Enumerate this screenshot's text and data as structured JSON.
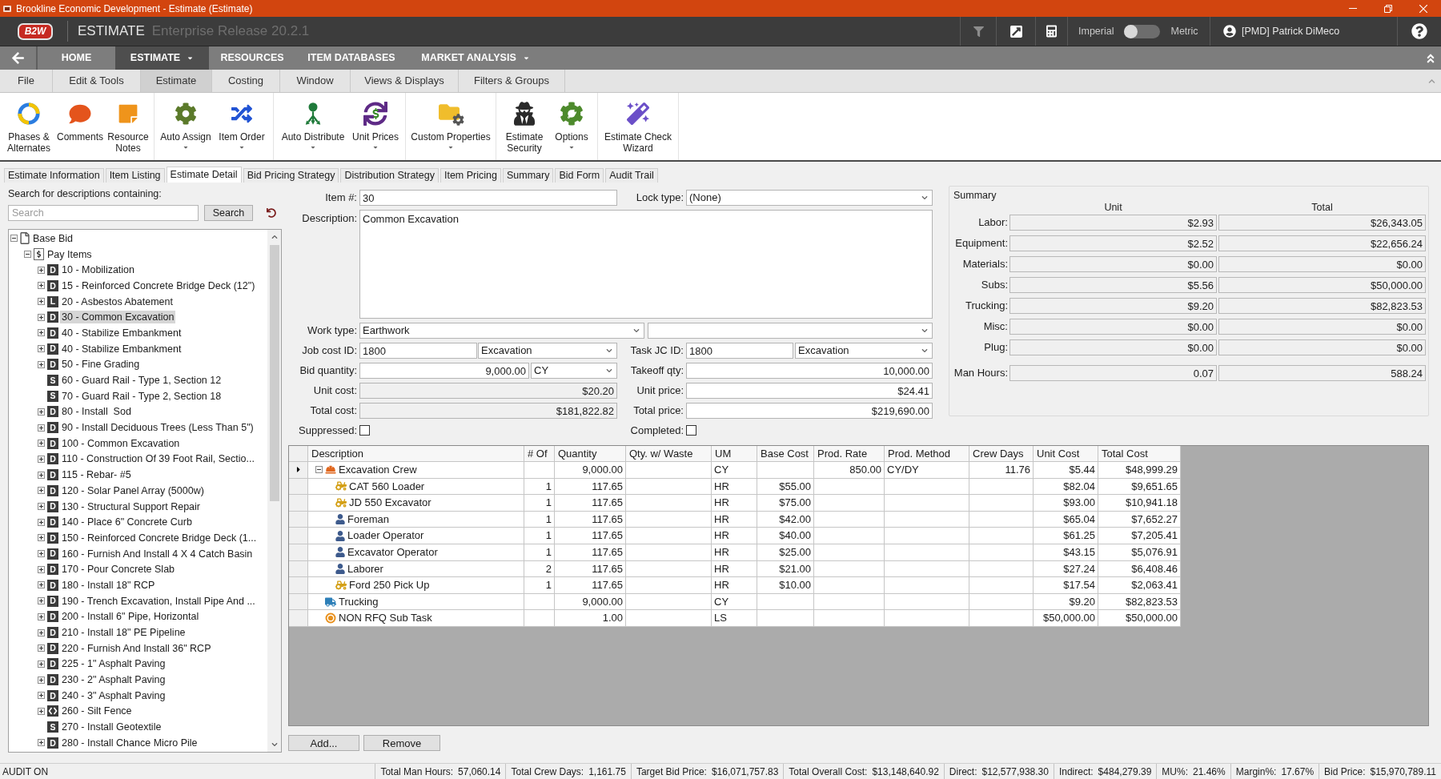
{
  "title_bar": {
    "title": "Brookline Economic Development - Estimate (Estimate)"
  },
  "header": {
    "logo": "B2W",
    "product": "ESTIMATE",
    "release": "Enterprise Release 20.2.1",
    "units": {
      "left": "Imperial",
      "right": "Metric",
      "metric": false
    },
    "user": "[PMD] Patrick DiMeco"
  },
  "nav": [
    {
      "label": "HOME",
      "selected": false,
      "dropdown": false
    },
    {
      "label": "ESTIMATE",
      "selected": true,
      "dropdown": true
    },
    {
      "label": "RESOURCES",
      "selected": false,
      "dropdown": false
    },
    {
      "label": "ITEM DATABASES",
      "selected": false,
      "dropdown": false
    },
    {
      "label": "MARKET ANALYSIS",
      "selected": false,
      "dropdown": true
    }
  ],
  "ribbon_tabs": [
    {
      "label": "File",
      "selected": false
    },
    {
      "label": "Edit & Tools",
      "selected": false
    },
    {
      "label": "Estimate",
      "selected": true
    },
    {
      "label": "Costing",
      "selected": false
    },
    {
      "label": "Window",
      "selected": false
    },
    {
      "label": "Views & Displays",
      "selected": false
    },
    {
      "label": "Filters & Groups",
      "selected": false
    }
  ],
  "ribbon_groups": [
    {
      "buttons": [
        {
          "label": "Phases & Alternates",
          "kind": "phases",
          "dropdown": false
        },
        {
          "label": "Comments",
          "kind": "comments",
          "dropdown": false
        },
        {
          "label": "Resource Notes",
          "kind": "notes",
          "dropdown": false
        }
      ]
    },
    {
      "buttons": [
        {
          "label": "Auto Assign",
          "kind": "assign",
          "dropdown": true
        },
        {
          "label": "Item Order",
          "kind": "order",
          "dropdown": true
        }
      ]
    },
    {
      "buttons": [
        {
          "label": "Auto Distribute",
          "kind": "distribute",
          "dropdown": true
        },
        {
          "label": "Unit Prices",
          "kind": "prices",
          "dropdown": true
        }
      ]
    },
    {
      "buttons": [
        {
          "label": "Custom Properties",
          "kind": "properties",
          "dropdown": true
        }
      ]
    },
    {
      "buttons": [
        {
          "label": "Estimate Security",
          "kind": "security",
          "dropdown": false
        },
        {
          "label": "Options",
          "kind": "options",
          "dropdown": true
        }
      ]
    },
    {
      "buttons": [
        {
          "label": "Estimate Check Wizard",
          "kind": "wizard",
          "dropdown": false
        }
      ]
    }
  ],
  "doc_tabs": [
    {
      "label": "Estimate Information",
      "selected": false
    },
    {
      "label": "Item Listing",
      "selected": false
    },
    {
      "label": "Estimate Detail",
      "selected": true
    },
    {
      "label": "Bid Pricing Strategy",
      "selected": false
    },
    {
      "label": "Distribution Strategy",
      "selected": false
    },
    {
      "label": "Item Pricing",
      "selected": false
    },
    {
      "label": "Summary",
      "selected": false
    },
    {
      "label": "Bid Form",
      "selected": false
    },
    {
      "label": "Audit Trail",
      "selected": false
    }
  ],
  "search": {
    "caption": "Search for descriptions containing:",
    "placeholder": "Search",
    "button": "Search"
  },
  "tree": [
    {
      "label": "Base Bid",
      "kind": "page",
      "has_children": true,
      "expanded": true,
      "selected": false,
      "children": [
        {
          "label": "Pay Items",
          "kind": "pay",
          "has_children": true,
          "expanded": true,
          "selected": false,
          "children": [
            {
              "label": "10 - Mobilization",
              "kind": "badge",
              "badge": "D",
              "has_children": true,
              "expanded": false,
              "selected": false
            },
            {
              "label": "15 - Reinforced Concrete Bridge Deck (12\")",
              "kind": "badge",
              "badge": "D",
              "has_children": true,
              "expanded": false,
              "selected": false
            },
            {
              "label": "20 - Asbestos Abatement",
              "kind": "badge",
              "badge": "L",
              "has_children": true,
              "expanded": false,
              "selected": false
            },
            {
              "label": "30 - Common Excavation",
              "kind": "badge",
              "badge": "D",
              "has_children": true,
              "expanded": false,
              "selected": true
            },
            {
              "label": "40 - Stabilize Embankment",
              "kind": "badge",
              "badge": "D",
              "has_children": true,
              "expanded": false,
              "selected": false
            },
            {
              "label": "40 - Stabilize Embankment",
              "kind": "badge",
              "badge": "D",
              "has_children": true,
              "expanded": false,
              "selected": false
            },
            {
              "label": "50 - Fine Grading",
              "kind": "badge",
              "badge": "D",
              "has_children": true,
              "expanded": false,
              "selected": false
            },
            {
              "label": "60 - Guard Rail - Type 1, Section 12",
              "kind": "badge",
              "badge": "S",
              "has_children": false,
              "selected": false
            },
            {
              "label": "70 - Guard Rail - Type 2, Section 18",
              "kind": "badge",
              "badge": "S",
              "has_children": false,
              "selected": false
            },
            {
              "label": "80 - Install  Sod",
              "kind": "badge",
              "badge": "D",
              "has_children": true,
              "expanded": false,
              "selected": false
            },
            {
              "label": "90 - Install Deciduous Trees (Less Than 5\")",
              "kind": "badge",
              "badge": "D",
              "has_children": true,
              "expanded": false,
              "selected": false
            },
            {
              "label": "100 - Common Excavation",
              "kind": "badge",
              "badge": "D",
              "has_children": true,
              "expanded": false,
              "selected": false
            },
            {
              "label": "110 - Construction Of 39 Foot Rail, Sectio...",
              "kind": "badge",
              "badge": "D",
              "has_children": true,
              "expanded": false,
              "selected": false
            },
            {
              "label": "115 - Rebar- #5",
              "kind": "badge",
              "badge": "D",
              "has_children": true,
              "expanded": false,
              "selected": false
            },
            {
              "label": "120 - Solar Panel Array (5000w)",
              "kind": "badge",
              "badge": "D",
              "has_children": true,
              "expanded": false,
              "selected": false
            },
            {
              "label": "130 - Structural Support Repair",
              "kind": "badge",
              "badge": "D",
              "has_children": true,
              "expanded": false,
              "selected": false
            },
            {
              "label": "140 - Place 6\" Concrete Curb",
              "kind": "badge",
              "badge": "D",
              "has_children": true,
              "expanded": false,
              "selected": false
            },
            {
              "label": "150 - Reinforced Concrete Bridge Deck (1...",
              "kind": "badge",
              "badge": "D",
              "has_children": true,
              "expanded": false,
              "selected": false
            },
            {
              "label": "160 - Furnish And Install 4 X 4 Catch Basin",
              "kind": "badge",
              "badge": "D",
              "has_children": true,
              "expanded": false,
              "selected": false
            },
            {
              "label": "170 - Pour Concrete Slab",
              "kind": "badge",
              "badge": "D",
              "has_children": true,
              "expanded": false,
              "selected": false
            },
            {
              "label": "180 - Install 18\" RCP",
              "kind": "badge",
              "badge": "D",
              "has_children": true,
              "expanded": false,
              "selected": false
            },
            {
              "label": "190 - Trench Excavation, Install Pipe And ...",
              "kind": "badge",
              "badge": "D",
              "has_children": true,
              "expanded": false,
              "selected": false
            },
            {
              "label": "200 - Install 6\" Pipe, Horizontal",
              "kind": "badge",
              "badge": "D",
              "has_children": true,
              "expanded": false,
              "selected": false
            },
            {
              "label": "210 - Install 18\" PE Pipeline",
              "kind": "badge",
              "badge": "D",
              "has_children": true,
              "expanded": false,
              "selected": false
            },
            {
              "label": "220 - Furnish And Install 36\" RCP",
              "kind": "badge",
              "badge": "D",
              "has_children": true,
              "expanded": false,
              "selected": false
            },
            {
              "label": "225 - 1\" Asphalt Paving",
              "kind": "badge",
              "badge": "D",
              "has_children": true,
              "expanded": false,
              "selected": false
            },
            {
              "label": "230 - 2\" Asphalt Paving",
              "kind": "badge",
              "badge": "D",
              "has_children": true,
              "expanded": false,
              "selected": false
            },
            {
              "label": "240 - 3\" Asphalt Paving",
              "kind": "badge",
              "badge": "D",
              "has_children": true,
              "expanded": false,
              "selected": false
            },
            {
              "label": "260 - Silt Fence",
              "kind": "linked",
              "has_children": true,
              "expanded": false,
              "selected": false
            },
            {
              "label": "270 - Install Geotextile",
              "kind": "badge",
              "badge": "S",
              "has_children": false,
              "selected": false
            },
            {
              "label": "280 - Install Chance Micro Pile",
              "kind": "badge",
              "badge": "D",
              "has_children": true,
              "expanded": false,
              "selected": false
            }
          ]
        }
      ]
    }
  ],
  "detail": {
    "item_no": {
      "label": "Item #:",
      "value": "30"
    },
    "lock_type": {
      "label": "Lock type:",
      "value": "(None)"
    },
    "description": {
      "label": "Description:",
      "value": "Common Excavation"
    },
    "work_type": {
      "label": "Work type:",
      "value": "Earthwork"
    },
    "job_cost_id": {
      "label": "Job cost ID:",
      "value": "1800",
      "phase": "Excavation"
    },
    "task_jc_id": {
      "label": "Task JC ID:",
      "value": "1800",
      "phase": "Excavation"
    },
    "bid_quantity": {
      "label": "Bid quantity:",
      "value": "9,000.00",
      "unit": "CY"
    },
    "takeoff_qty": {
      "label": "Takeoff qty:",
      "value": "10,000.00"
    },
    "unit_cost": {
      "label": "Unit cost:",
      "value": "$20.20"
    },
    "unit_price": {
      "label": "Unit price:",
      "value": "$24.41"
    },
    "total_cost": {
      "label": "Total cost:",
      "value": "$181,822.82"
    },
    "total_price": {
      "label": "Total price:",
      "value": "$219,690.00"
    },
    "suppressed": {
      "label": "Suppressed:",
      "checked": false
    },
    "completed": {
      "label": "Completed:",
      "checked": false
    }
  },
  "summary": {
    "title": "Summary",
    "columns": [
      "Unit",
      "Total"
    ],
    "rows": [
      {
        "label": "Labor:",
        "unit": "$2.93",
        "total": "$26,343.05"
      },
      {
        "label": "Equipment:",
        "unit": "$2.52",
        "total": "$22,656.24"
      },
      {
        "label": "Materials:",
        "unit": "$0.00",
        "total": "$0.00"
      },
      {
        "label": "Subs:",
        "unit": "$5.56",
        "total": "$50,000.00"
      },
      {
        "label": "Trucking:",
        "unit": "$9.20",
        "total": "$82,823.53"
      },
      {
        "label": "Misc:",
        "unit": "$0.00",
        "total": "$0.00"
      },
      {
        "label": "Plug:",
        "unit": "$0.00",
        "total": "$0.00"
      }
    ],
    "man_hours": {
      "label": "Man Hours:",
      "unit": "0.07",
      "total": "588.24"
    }
  },
  "grid": {
    "columns": [
      "Description",
      "# Of",
      "Quantity",
      "Qty. w/ Waste",
      "UM",
      "Base Cost",
      "Prod. Rate",
      "Prod. Method",
      "Crew Days",
      "Unit Cost",
      "Total Cost"
    ],
    "rows": [
      {
        "kind": "crew",
        "current": true,
        "expanded": true,
        "cells": {
          "description": "Excavation Crew",
          "quantity": "9,000.00",
          "um": "CY",
          "prod_rate": "850.00",
          "prod_method": "CY/DY",
          "crew_days": "11.76",
          "unit_cost": "$5.44",
          "total_cost": "$48,999.29"
        },
        "children": [
          {
            "kind": "equipment",
            "current": false,
            "cells": {
              "description": "CAT 560 Loader",
              "count": "1",
              "quantity": "117.65",
              "um": "HR",
              "base_cost": "$55.00",
              "unit_cost": "$82.04",
              "total_cost": "$9,651.65"
            }
          },
          {
            "kind": "equipment",
            "current": false,
            "cells": {
              "description": "JD 550 Excavator",
              "count": "1",
              "quantity": "117.65",
              "um": "HR",
              "base_cost": "$75.00",
              "unit_cost": "$93.00",
              "total_cost": "$10,941.18"
            }
          },
          {
            "kind": "labor",
            "current": false,
            "cells": {
              "description": "Foreman",
              "count": "1",
              "quantity": "117.65",
              "um": "HR",
              "base_cost": "$42.00",
              "unit_cost": "$65.04",
              "total_cost": "$7,652.27"
            }
          },
          {
            "kind": "labor",
            "current": false,
            "cells": {
              "description": "Loader Operator",
              "count": "1",
              "quantity": "117.65",
              "um": "HR",
              "base_cost": "$40.00",
              "unit_cost": "$61.25",
              "total_cost": "$7,205.41"
            }
          },
          {
            "kind": "labor",
            "current": false,
            "cells": {
              "description": "Excavator Operator",
              "count": "1",
              "quantity": "117.65",
              "um": "HR",
              "base_cost": "$25.00",
              "unit_cost": "$43.15",
              "total_cost": "$5,076.91"
            }
          },
          {
            "kind": "labor",
            "current": false,
            "cells": {
              "description": "Laborer",
              "count": "2",
              "quantity": "117.65",
              "um": "HR",
              "base_cost": "$21.00",
              "unit_cost": "$27.24",
              "total_cost": "$6,408.46"
            }
          },
          {
            "kind": "equipment",
            "current": false,
            "cells": {
              "description": "Ford 250 Pick Up",
              "count": "1",
              "quantity": "117.65",
              "um": "HR",
              "base_cost": "$10.00",
              "unit_cost": "$17.54",
              "total_cost": "$2,063.41"
            }
          }
        ]
      },
      {
        "kind": "trucking",
        "current": false,
        "cells": {
          "description": "Trucking",
          "quantity": "9,000.00",
          "um": "CY",
          "unit_cost": "$9.20",
          "total_cost": "$82,823.53"
        }
      },
      {
        "kind": "sub",
        "current": false,
        "cells": {
          "description": "NON RFQ Sub Task",
          "quantity": "1.00",
          "um": "LS",
          "unit_cost": "$50,000.00",
          "total_cost": "$50,000.00"
        }
      }
    ]
  },
  "grid_buttons": [
    "Add...",
    "Remove"
  ],
  "status_bar": {
    "mode": "AUDIT ON",
    "totals": [
      {
        "label": "Total Man Hours:",
        "value": "57,060.14"
      },
      {
        "label": "Total Crew Days:",
        "value": "1,161.75"
      },
      {
        "label": "Target Bid Price:",
        "value": "$16,071,757.83"
      },
      {
        "label": "Total Overall Cost:",
        "value": "$13,148,640.92"
      },
      {
        "label": "Direct:",
        "value": "$12,577,938.30"
      },
      {
        "label": "Indirect:",
        "value": "$484,279.39"
      },
      {
        "label": "MU%:",
        "value": "21.46%"
      },
      {
        "label": "Margin%:",
        "value": "17.67%"
      },
      {
        "label": "Bid Price:",
        "value": "$15,970,789.11"
      }
    ]
  }
}
